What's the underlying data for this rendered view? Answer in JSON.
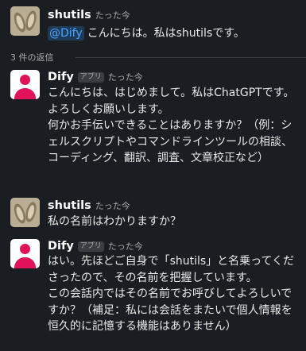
{
  "thread": {
    "parent": {
      "sender": "shutils",
      "time": "たった今",
      "mention": "@Dify",
      "text": "こんにちは。私はshutilsです。"
    },
    "reply_count_label": "3 件の返信",
    "replies": [
      {
        "sender": "Dify",
        "badge": "アプリ",
        "time": "たった今",
        "text": "こんにちは、はじめまして。私はChatGPTです。よろしくお願いします。\n何かお手伝いできることはありますか？（例：シェルスクリプトやコマンドラインツールの相談、コーディング、翻訳、調査、文章校正など）"
      },
      {
        "sender": "shutils",
        "time": "たった今",
        "text": "私の名前はわかりますか？"
      },
      {
        "sender": "Dify",
        "badge": "アプリ",
        "time": "たった今",
        "text": "はい。先ほどご自身で「shutils」と名乗ってくださったので、その名前を把握しています。\nこの会話内ではその名前でお呼びしてよろしいですか？（補足：私には会話をまたいで個人情報を恒久的に記憶する機能はありません）"
      }
    ]
  }
}
